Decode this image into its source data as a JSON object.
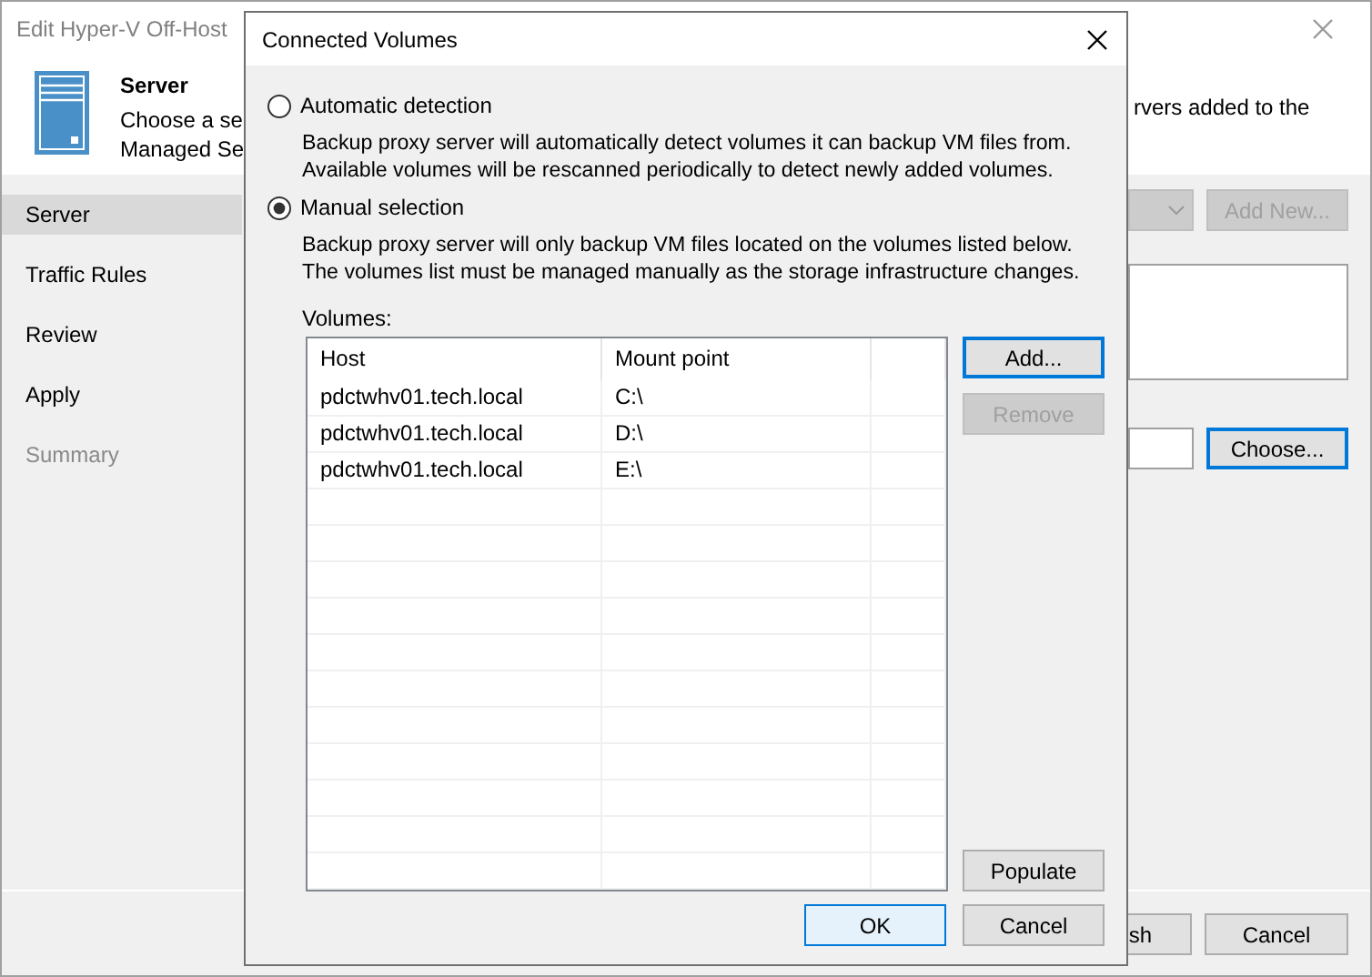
{
  "window": {
    "title": "Edit Hyper-V Off-Host"
  },
  "header": {
    "title": "Server",
    "description_left": [
      "Choose a se",
      "Managed Se"
    ],
    "description_right": "rvers added to the"
  },
  "sidebar": {
    "items": [
      {
        "label": "Server",
        "selected": true,
        "disabled": false
      },
      {
        "label": "Traffic Rules",
        "selected": false,
        "disabled": false
      },
      {
        "label": "Review",
        "selected": false,
        "disabled": false
      },
      {
        "label": "Apply",
        "selected": false,
        "disabled": false
      },
      {
        "label": "Summary",
        "selected": false,
        "disabled": true
      }
    ]
  },
  "main": {
    "server_dropdown": {
      "disabled": true
    },
    "add_new_button": {
      "label": "Add New...",
      "disabled": true
    },
    "choose_button": {
      "label": "Choose...",
      "focused": true
    }
  },
  "footer": {
    "buttons": [
      {
        "label": "sh",
        "disabled": false,
        "focused": false
      },
      {
        "label": "Cancel",
        "disabled": false,
        "focused": false
      }
    ]
  },
  "dialog": {
    "title": "Connected Volumes",
    "options": [
      {
        "label": "Automatic detection",
        "selected": false,
        "description": [
          "Backup proxy server will automatically detect volumes it can backup VM files from.",
          "Available volumes will be rescanned periodically to detect newly added volumes."
        ]
      },
      {
        "label": "Manual selection",
        "selected": true,
        "description": [
          "Backup proxy server will only backup VM files located on the volumes listed below.",
          "The volumes list must be managed manually as the storage infrastructure changes."
        ]
      }
    ],
    "volumes_label": "Volumes:",
    "table": {
      "columns": [
        "Host",
        "Mount point"
      ],
      "rows": [
        {
          "host": "pdctwhv01.tech.local",
          "mount_point": "C:\\"
        },
        {
          "host": "pdctwhv01.tech.local",
          "mount_point": "D:\\"
        },
        {
          "host": "pdctwhv01.tech.local",
          "mount_point": "E:\\"
        }
      ]
    },
    "side_buttons": [
      {
        "label": "Add...",
        "disabled": false,
        "focused": true
      },
      {
        "label": "Remove",
        "disabled": true,
        "focused": false
      }
    ],
    "populate_button": {
      "label": "Populate",
      "disabled": false,
      "focused": false
    },
    "buttons": [
      {
        "label": "OK",
        "default": true
      },
      {
        "label": "Cancel",
        "default": false
      }
    ]
  }
}
